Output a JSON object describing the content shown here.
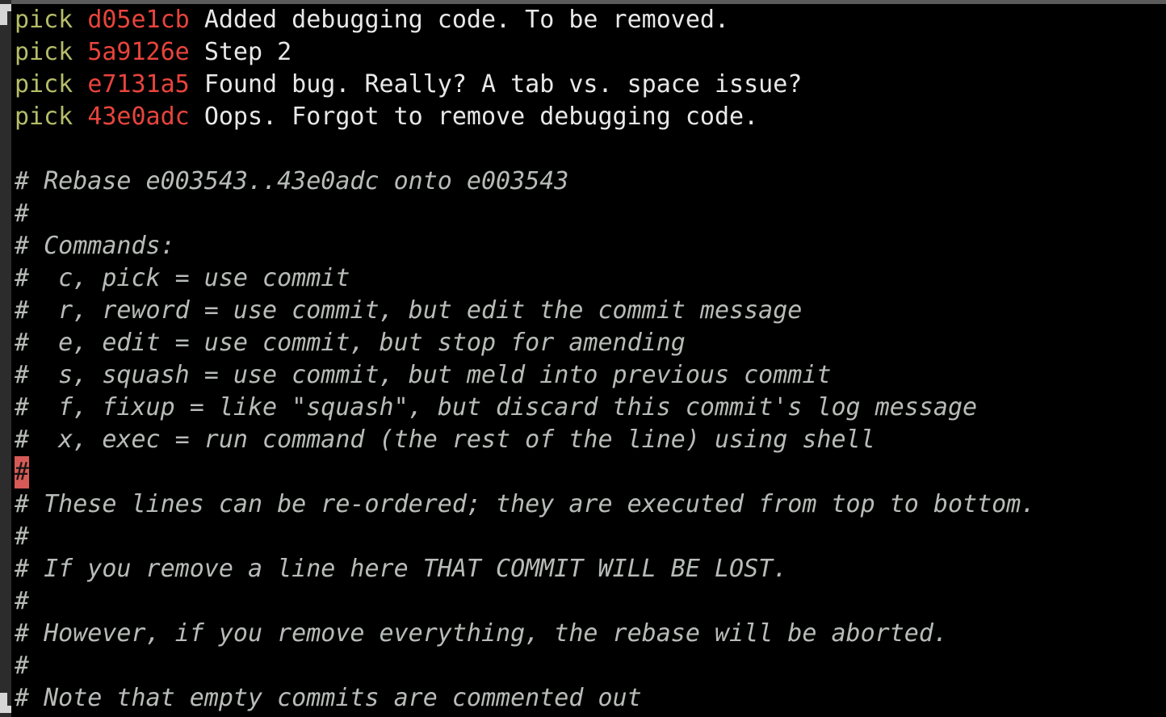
{
  "window": {
    "kind": "terminal-editor",
    "background_color": "#000000",
    "border_color": "#2c2c2c",
    "titlebar_color": "#5b5b5b",
    "corner_mark_color": "#d6d6d6"
  },
  "colors": {
    "command_keyword": "#b5bd68",
    "commit_hash": "#e8443c",
    "commit_subject": "#e8e8e8",
    "comment": "#b8bcb8",
    "cursor_background": "#d65a56",
    "cursor_foreground": "#121212"
  },
  "editor": {
    "cursor": {
      "line_index": 13,
      "column": 1,
      "character": "#"
    }
  },
  "todo": {
    "commits": [
      {
        "command": "pick",
        "hash": "d05e1cb",
        "subject": "Added debugging code. To be removed."
      },
      {
        "command": "pick",
        "hash": "5a9126e",
        "subject": "Step 2"
      },
      {
        "command": "pick",
        "hash": "e7131a5",
        "subject": "Found bug. Really? A tab vs. space issue?"
      },
      {
        "command": "pick",
        "hash": "43e0adc",
        "subject": "Oops. Forgot to remove debugging code."
      }
    ]
  },
  "lines": [
    {
      "type": "commit",
      "index": 0
    },
    {
      "type": "commit",
      "index": 1
    },
    {
      "type": "commit",
      "index": 2
    },
    {
      "type": "commit",
      "index": 3
    },
    {
      "type": "blank",
      "text": ""
    },
    {
      "type": "comment",
      "text": "# Rebase e003543..43e0adc onto e003543"
    },
    {
      "type": "comment",
      "text": "#"
    },
    {
      "type": "comment",
      "text": "# Commands:"
    },
    {
      "type": "comment",
      "text": "#  c, pick = use commit"
    },
    {
      "type": "comment",
      "text": "#  r, reword = use commit, but edit the commit message"
    },
    {
      "type": "comment",
      "text": "#  e, edit = use commit, but stop for amending"
    },
    {
      "type": "comment",
      "text": "#  s, squash = use commit, but meld into previous commit"
    },
    {
      "type": "comment",
      "text": "#  f, fixup = like \"squash\", but discard this commit's log message"
    },
    {
      "type": "comment",
      "text": "#  x, exec = run command (the rest of the line) using shell"
    },
    {
      "type": "cursor-comment",
      "text": "#"
    },
    {
      "type": "comment",
      "text": "# These lines can be re-ordered; they are executed from top to bottom."
    },
    {
      "type": "comment",
      "text": "#"
    },
    {
      "type": "comment",
      "text": "# If you remove a line here THAT COMMIT WILL BE LOST."
    },
    {
      "type": "comment",
      "text": "#"
    },
    {
      "type": "comment",
      "text": "# However, if you remove everything, the rebase will be aborted."
    },
    {
      "type": "comment",
      "text": "#"
    },
    {
      "type": "comment",
      "text": "# Note that empty commits are commented out"
    }
  ],
  "rebase_info": {
    "range": "e003543..43e0adc",
    "onto": "e003543"
  },
  "command_reference": [
    {
      "abbrev": "c",
      "name": "pick",
      "description": "use commit"
    },
    {
      "abbrev": "r",
      "name": "reword",
      "description": "use commit, but edit the commit message"
    },
    {
      "abbrev": "e",
      "name": "edit",
      "description": "use commit, but stop for amending"
    },
    {
      "abbrev": "s",
      "name": "squash",
      "description": "use commit, but meld into previous commit"
    },
    {
      "abbrev": "f",
      "name": "fixup",
      "description": "like \"squash\", but discard this commit's log message"
    },
    {
      "abbrev": "x",
      "name": "exec",
      "description": "run command (the rest of the line) using shell"
    }
  ]
}
